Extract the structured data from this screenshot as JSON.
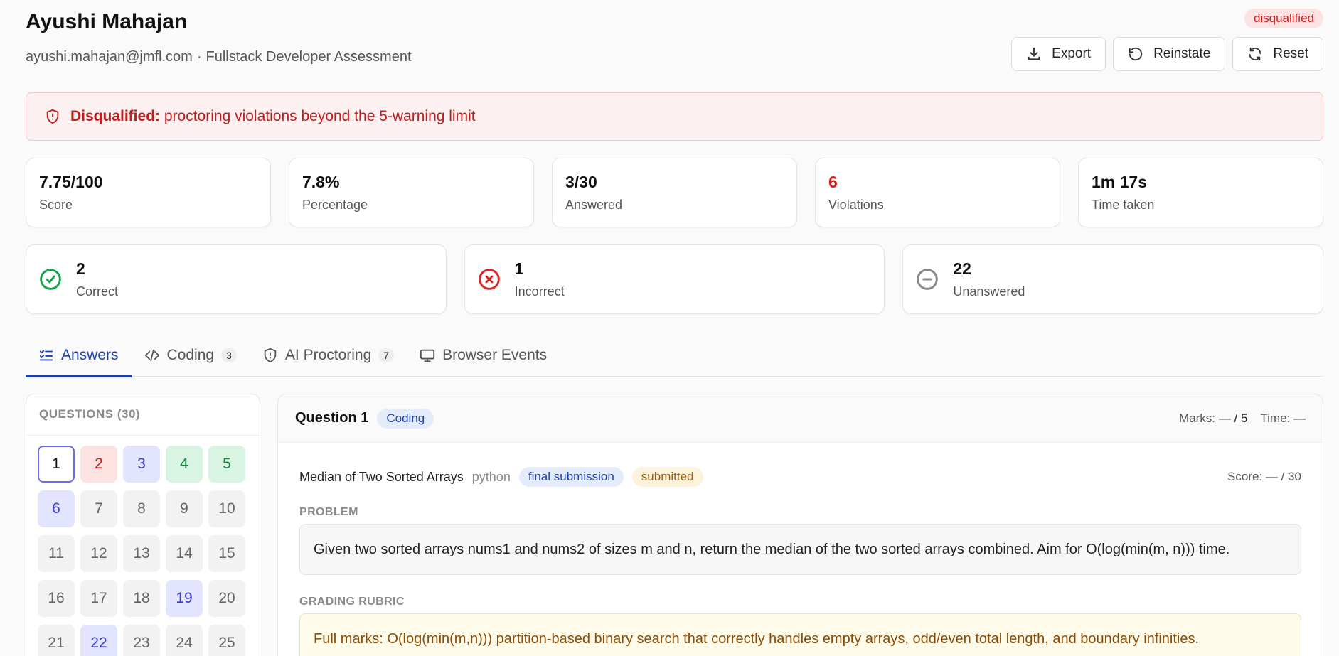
{
  "candidate": {
    "name": "Ayushi Mahajan",
    "email": "ayushi.mahajan@jmfl.com",
    "separator": "·",
    "assessment": "Fullstack Developer Assessment",
    "status": "disqualified"
  },
  "actions": {
    "export": "Export",
    "reinstate": "Reinstate",
    "reset": "Reset"
  },
  "alert": {
    "title": "Disqualified:",
    "message": "proctoring violations beyond the 5-warning limit"
  },
  "stats": [
    {
      "value": "7.75/100",
      "label": "Score"
    },
    {
      "value": "7.8%",
      "label": "Percentage"
    },
    {
      "value": "3/30",
      "label": "Answered"
    },
    {
      "value": "6",
      "label": "Violations"
    },
    {
      "value": "1m 17s",
      "label": "Time taken"
    }
  ],
  "results": [
    {
      "value": "2",
      "label": "Correct",
      "color": "#16a34a"
    },
    {
      "value": "1",
      "label": "Incorrect",
      "color": "#dc2626"
    },
    {
      "value": "22",
      "label": "Unanswered",
      "color": "#888888"
    }
  ],
  "tabs": [
    {
      "label": "Answers",
      "count": ""
    },
    {
      "label": "Coding",
      "count": "3"
    },
    {
      "label": "AI Proctoring",
      "count": "7"
    },
    {
      "label": "Browser Events",
      "count": ""
    }
  ],
  "questions": {
    "title": "QUESTIONS (30)",
    "cells": [
      "1",
      "2",
      "3",
      "4",
      "5",
      "6",
      "7",
      "8",
      "9",
      "10",
      "11",
      "12",
      "13",
      "14",
      "15",
      "16",
      "17",
      "18",
      "19",
      "20",
      "21",
      "22",
      "23",
      "24",
      "25"
    ]
  },
  "detail": {
    "title": "Question 1",
    "type": "Coding",
    "marks_label": "Marks: —",
    "marks_total": "/ 5",
    "time": "Time: —",
    "problem_name": "Median of Two Sorted Arrays",
    "language": "python",
    "submission_chip": "final submission",
    "status_chip": "submitted",
    "score": "Score: — / 30",
    "problem_label": "PROBLEM",
    "problem_text": "Given two sorted arrays nums1 and nums2 of sizes m and n, return the median of the two sorted arrays combined. Aim for O(log(min(m, n))) time.",
    "rubric_label": "GRADING RUBRIC",
    "rubric_text": "Full marks: O(log(min(m,n))) partition-based binary search that correctly handles empty arrays, odd/even total length, and boundary infinities."
  },
  "colors": {
    "accent": "#1e40af",
    "danger": "#c81e1e"
  }
}
